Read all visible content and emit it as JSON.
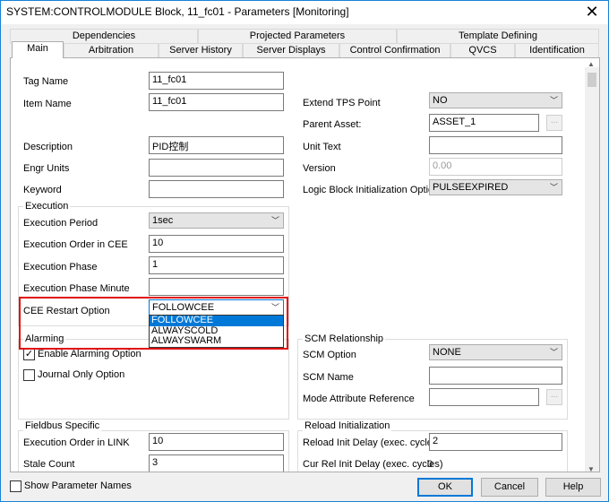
{
  "window": {
    "title": "SYSTEM:CONTROLMODULE Block, 11_fc01 - Parameters [Monitoring]",
    "close_glyph": "✕"
  },
  "tabs": {
    "row1": [
      "Dependencies",
      "Projected Parameters",
      "Template Defining"
    ],
    "row2": [
      "Main",
      "Arbitration",
      "Server History",
      "Server Displays",
      "Control Confirmation",
      "QVCS",
      "Identification"
    ]
  },
  "left": {
    "tag_name_label": "Tag Name",
    "tag_name_value": "11_fc01",
    "item_name_label": "Item Name",
    "item_name_value": "11_fc01",
    "description_label": "Description",
    "description_value": "PID控制",
    "engr_units_label": "Engr Units",
    "engr_units_value": "",
    "keyword_label": "Keyword",
    "keyword_value": ""
  },
  "execution": {
    "title": "Execution",
    "period_label": "Execution Period",
    "period_value": "1sec",
    "order_label": "Execution Order in CEE",
    "order_value": "10",
    "phase_label": "Execution Phase",
    "phase_value": "1",
    "phase_minute_label": "Execution Phase Minute",
    "phase_minute_value": "",
    "cee_restart_label": "CEE Restart Option",
    "cee_restart_value": "FOLLOWCEE",
    "cee_restart_options": [
      "FOLLOWCEE",
      "ALWAYSCOLD",
      "ALWAYSWARM"
    ]
  },
  "alarming": {
    "title": "Alarming",
    "enable_label": "Enable Alarming Option",
    "enable_checked": true,
    "journal_label": "Journal Only Option",
    "journal_checked": false,
    "check_glyph": "✓"
  },
  "right": {
    "extend_tps_label": "Extend TPS Point",
    "extend_tps_value": "NO",
    "parent_asset_label": "Parent Asset:",
    "parent_asset_value": "ASSET_1",
    "unit_text_label": "Unit Text",
    "unit_text_value": "",
    "version_label": "Version",
    "version_value": "0.00",
    "logic_init_label": "Logic Block Initialization Option",
    "logic_init_value": "PULSEEXPIRED",
    "browse_glyph": "..."
  },
  "scm": {
    "title": "SCM Relationship",
    "option_label": "SCM Option",
    "option_value": "NONE",
    "name_label": "SCM Name",
    "name_value": "",
    "mode_attr_label": "Mode Attribute Reference",
    "mode_attr_value": ""
  },
  "fieldbus": {
    "title": "Fieldbus Specific",
    "exec_order_label": "Execution Order in LINK",
    "exec_order_value": "10",
    "stale_count_label": "Stale Count",
    "stale_count_value": "3"
  },
  "reload": {
    "title": "Reload Initialization",
    "delay_label": "Reload Init Delay (exec. cycles)",
    "delay_value": "2",
    "cur_delay_label": "Cur Rel Init Delay (exec. cycles)",
    "cur_delay_value": "0"
  },
  "footer": {
    "show_names_label": "Show Parameter Names",
    "show_names_checked": false,
    "ok_label": "OK",
    "cancel_label": "Cancel",
    "help_label": "Help"
  },
  "dropdown_glyph": "﹀",
  "scroll_up_glyph": "▲",
  "scroll_down_glyph": "▼"
}
